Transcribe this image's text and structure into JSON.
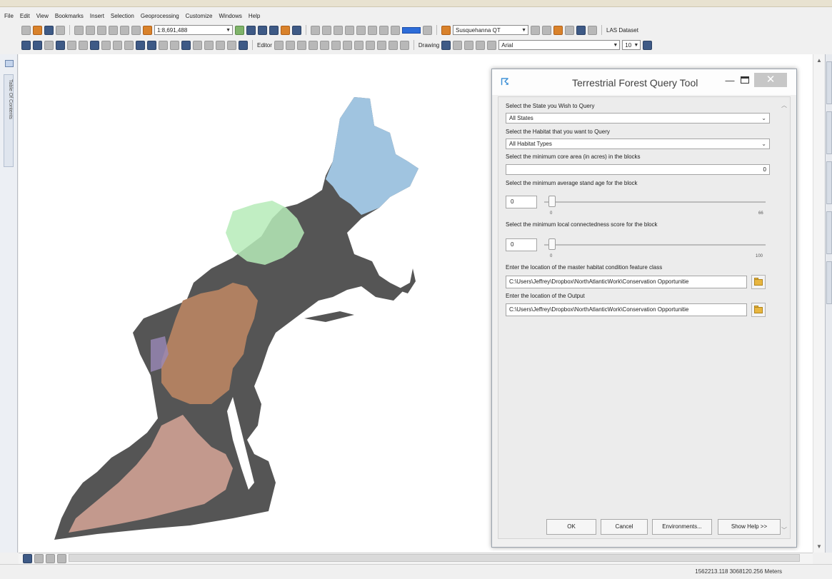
{
  "menu": [
    "File",
    "Edit",
    "View",
    "Bookmarks",
    "Insert",
    "Selection",
    "Geoprocessing",
    "Customize",
    "Windows",
    "Help"
  ],
  "toolbar": {
    "scale": "1:8,691,488",
    "layer_combo": "Susquehanna QT",
    "las_label": "LAS Dataset",
    "editor_label": "Editor",
    "drawing_label": "Drawing",
    "font_combo": "Arial",
    "font_size": "10"
  },
  "toc": {
    "label": "Table Of Contents"
  },
  "dialog": {
    "title": "Terrestrial Forest Query Tool",
    "minimize": "—",
    "close": "✕",
    "state_label": "Select the State you Wish to Query",
    "state_value": "All States",
    "habitat_label": "Select the Habitat that you want to Query",
    "habitat_value": "All Habitat Types",
    "core_label": "Select the minimum core area (in acres)  in the blocks",
    "core_value": "0",
    "age_label": "Select the minimum average stand age for the block",
    "age_value": "0",
    "age_min": "0",
    "age_max": "66",
    "conn_label": "Select the minimum local connectedness score for the block",
    "conn_value": "0",
    "conn_min": "0",
    "conn_max": "100",
    "master_label": "Enter the location of the master habitat condition feature class",
    "master_path": "C:\\Users\\Jeffrey\\Dropbox\\NorthAtlanticWork\\Conservation Opportunitie",
    "output_label": "Enter the location of the Output",
    "output_path": "C:\\Users\\Jeffrey\\Dropbox\\NorthAtlanticWork\\Conservation Opportunitie",
    "buttons": {
      "ok": "OK",
      "cancel": "Cancel",
      "environments": "Environments...",
      "help": "Show Help >>"
    }
  },
  "status": {
    "coords": "1562213.118  3068120.256 Meters"
  },
  "colors": {
    "land": "#555555",
    "blue_region": "#a9d0f0",
    "green_region": "#b6ebb8",
    "orange_region": "#b08061",
    "pink_region": "#e8b0a0",
    "purple_region": "#9a88b8"
  }
}
